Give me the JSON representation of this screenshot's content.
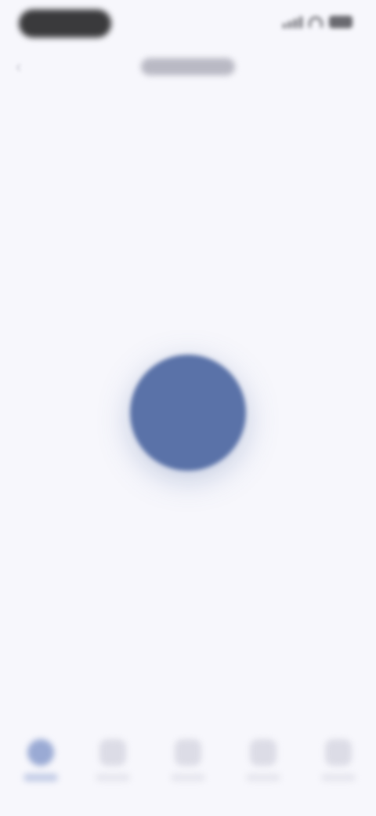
{
  "status_bar": {
    "time": ""
  },
  "header": {
    "title": ""
  },
  "main": {
    "center_button_color": "#5a72a8"
  },
  "tab_bar": {
    "active_tab": 0,
    "tabs": [
      {
        "label": "",
        "icon": "home-icon"
      },
      {
        "label": "",
        "icon": "calendar-icon"
      },
      {
        "label": "",
        "icon": "heart-icon"
      },
      {
        "label": "",
        "icon": "profile-icon"
      },
      {
        "label": "",
        "icon": "more-icon"
      }
    ]
  },
  "colors": {
    "background": "#f7f7fc",
    "accent": "#5a72a8"
  }
}
